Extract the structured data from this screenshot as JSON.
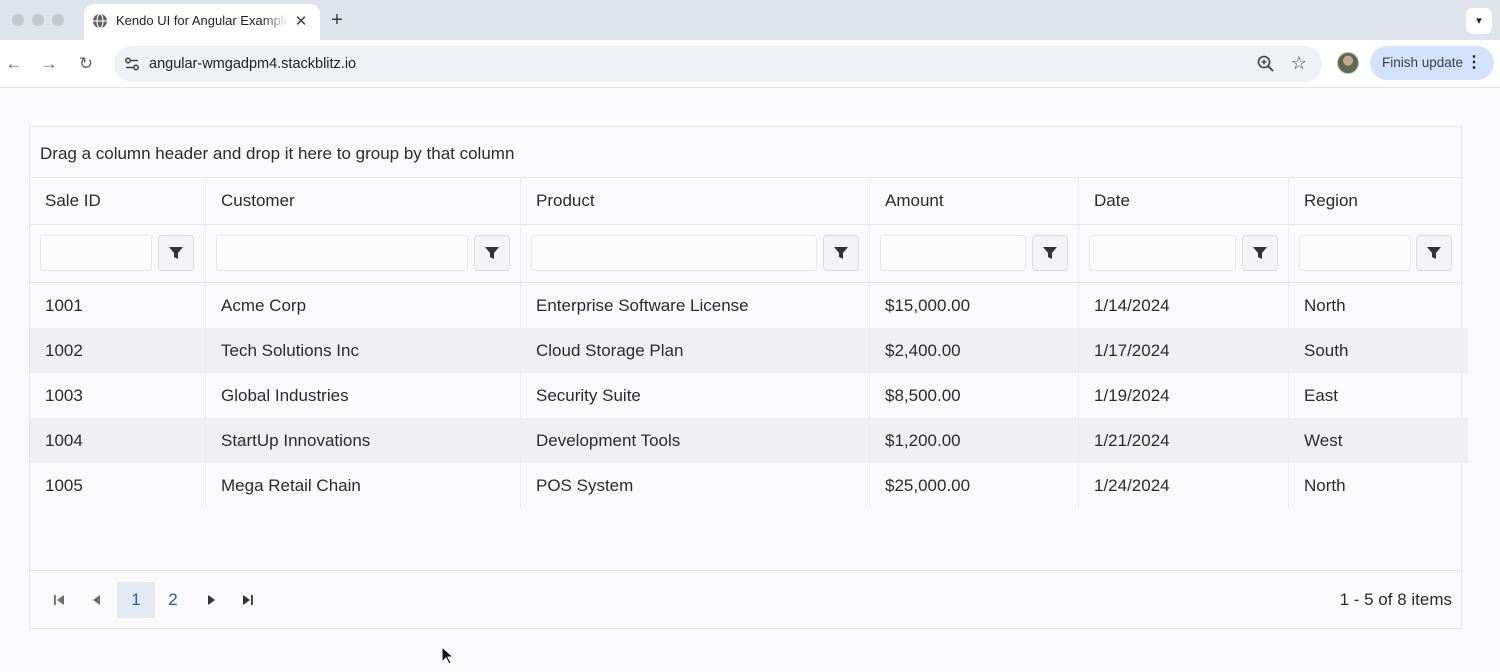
{
  "browser": {
    "tab_title": "Kendo UI for Angular Examples",
    "tab_close": "✕",
    "new_tab": "+",
    "url": "angular-wmgadpm4.stackblitz.io",
    "finish_update": "Finish update",
    "icons": [
      "globe-icon",
      "back-arrow-icon",
      "forward-arrow-icon",
      "reload-icon",
      "site-info-icon",
      "zoom-icon",
      "star-icon",
      "menu-kebab-icon",
      "tab-search-icon"
    ]
  },
  "grid": {
    "group_hint": "Drag a column header and drop it here to group by that column",
    "columns": [
      {
        "label": "Sale ID"
      },
      {
        "label": "Customer"
      },
      {
        "label": "Product"
      },
      {
        "label": "Amount"
      },
      {
        "label": "Date"
      },
      {
        "label": "Region"
      }
    ],
    "rows": [
      {
        "sale_id": "1001",
        "customer": "Acme Corp",
        "product": "Enterprise Software License",
        "amount": "$15,000.00",
        "date": "1/14/2024",
        "region": "North"
      },
      {
        "sale_id": "1002",
        "customer": "Tech Solutions Inc",
        "product": "Cloud Storage Plan",
        "amount": "$2,400.00",
        "date": "1/17/2024",
        "region": "South"
      },
      {
        "sale_id": "1003",
        "customer": "Global Industries",
        "product": "Security Suite",
        "amount": "$8,500.00",
        "date": "1/19/2024",
        "region": "East"
      },
      {
        "sale_id": "1004",
        "customer": "StartUp Innovations",
        "product": "Development Tools",
        "amount": "$1,200.00",
        "date": "1/21/2024",
        "region": "West"
      },
      {
        "sale_id": "1005",
        "customer": "Mega Retail Chain",
        "product": "POS System",
        "amount": "$25,000.00",
        "date": "1/24/2024",
        "region": "North"
      }
    ],
    "pager": {
      "pages": [
        "1",
        "2"
      ],
      "current_page": "1",
      "info": "1 - 5 of 8 items"
    }
  },
  "colors": {
    "accent": "#1f5fae",
    "alt_row": "#f0f0f3",
    "update_button": "#d3e3fd"
  }
}
